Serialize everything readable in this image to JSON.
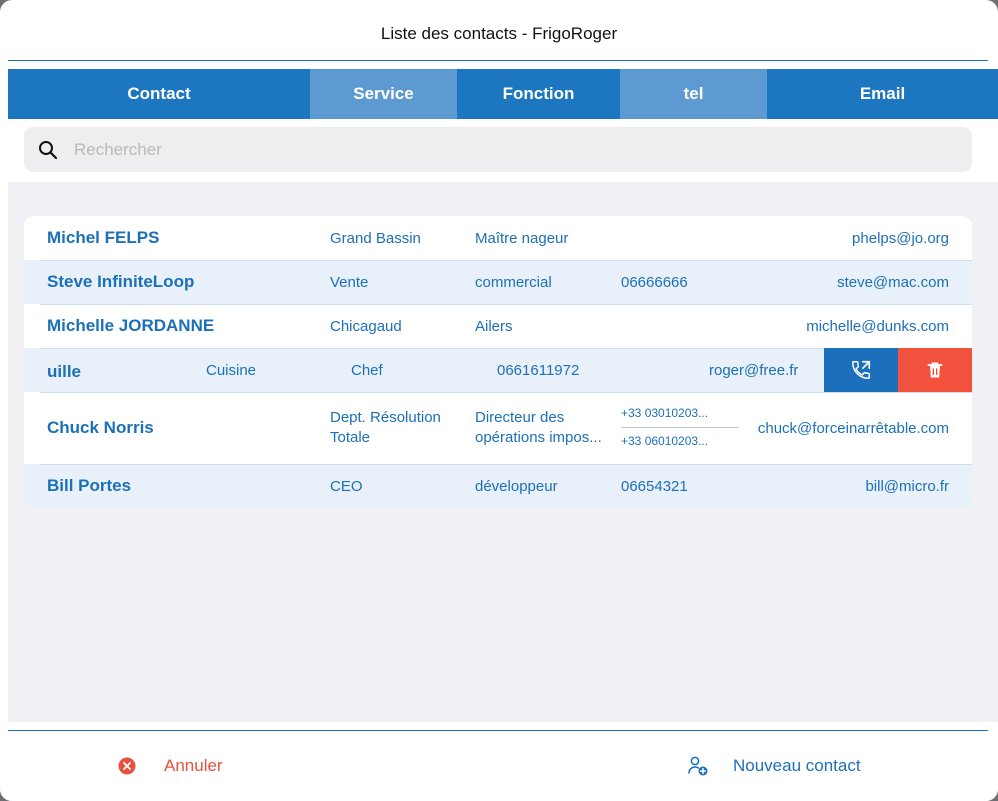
{
  "window": {
    "title": "Liste des contacts - FrigoRoger"
  },
  "columns": [
    "Contact",
    "Service",
    "Fonction",
    "tel",
    "Email"
  ],
  "search": {
    "placeholder": "Rechercher",
    "value": ""
  },
  "contacts": [
    {
      "name": "Michel FELPS",
      "service": "Grand Bassin",
      "fonction": "Maître nageur",
      "tel": "",
      "email": "phelps@jo.org"
    },
    {
      "name": "Steve InfiniteLoop",
      "service": "Vente",
      "fonction": "commercial",
      "tel": "06666666",
      "email": "steve@mac.com"
    },
    {
      "name": "Michelle JORDANNE",
      "service": "Chicagaud",
      "fonction": "Ailers",
      "tel": "",
      "email": "michelle@dunks.com"
    },
    {
      "name": "uille",
      "service": "Cuisine",
      "fonction": "Chef",
      "tel": "0661611972",
      "email": "roger@free.fr"
    },
    {
      "name": "Chuck Norris",
      "service_l1": "Dept. Résolution",
      "service_l2": "Totale",
      "fonction_l1": "Directeur des",
      "fonction_l2": "opérations impos...",
      "tel1": "+33 03010203...",
      "tel2": "+33 06010203...",
      "email": "chuck@forceinarrêtable.com"
    },
    {
      "name": "Bill Portes",
      "service": "CEO",
      "fonction": "développeur",
      "tel": "06654321",
      "email": "bill@micro.fr"
    }
  ],
  "swipe_actions": {
    "call_icon": "phone-forward-icon",
    "delete_icon": "trash-icon"
  },
  "footer": {
    "cancel_label": "Annuler",
    "new_contact_label": "Nouveau contact"
  },
  "colors": {
    "accent": "#1c76c0",
    "accent_alt": "#5d9ad2",
    "danger": "#f2513e",
    "row_alt": "#e8f0f9"
  }
}
